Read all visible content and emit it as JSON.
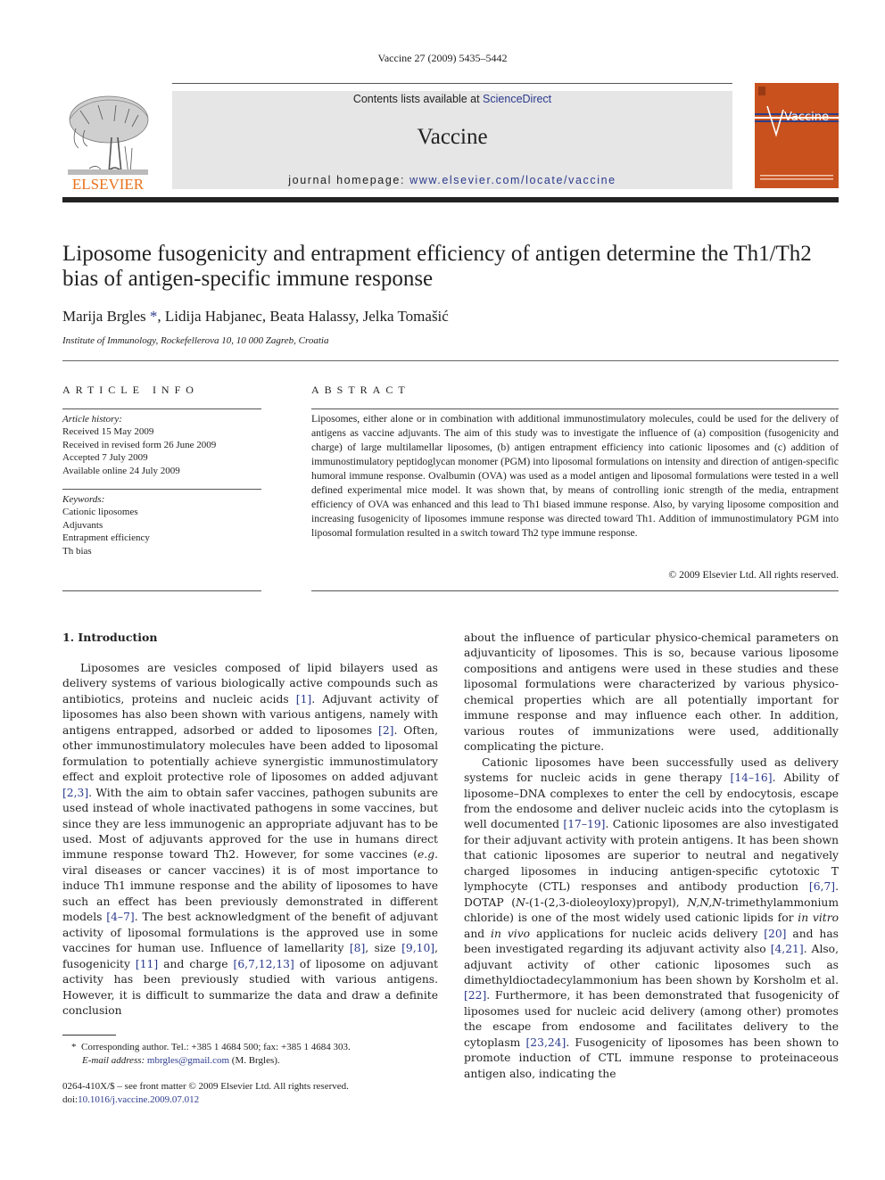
{
  "header": {
    "journal_ref": "Vaccine 27 (2009) 5435–5442",
    "contents_prefix": "Contents lists available at ",
    "contents_link": "ScienceDirect",
    "journal_name": "Vaccine",
    "homepage_prefix": "journal homepage: ",
    "homepage_link": "www.elsevier.com/locate/vaccine",
    "publisher_logo_text": "ELSEVIER",
    "cover_title": "Vaccine",
    "colors": {
      "publisher_orange": "#e9711c",
      "cover_orange": "#c8511e",
      "link_blue": "#2b3a8c",
      "header_gray": "#e6e6e6"
    }
  },
  "article": {
    "title": "Liposome fusogenicity and entrapment efficiency of antigen determine the Th1/Th2 bias of antigen-specific immune response",
    "authors_first": "Marija Brgles",
    "author_mark": "*",
    "authors_rest": ", Lidija Habjanec, Beata Halassy, Jelka Tomašić",
    "affiliation": "Institute of Immunology, Rockefellerova 10, 10 000 Zagreb, Croatia"
  },
  "article_info": {
    "heading": "ARTICLE INFO",
    "history_label": "Article history:",
    "history": [
      "Received 15 May 2009",
      "Received in revised form 26 June 2009",
      "Accepted 7 July 2009",
      "Available online 24 July 2009"
    ],
    "keywords_label": "Keywords:",
    "keywords": [
      "Cationic liposomes",
      "Adjuvants",
      "Entrapment efficiency",
      "Th bias"
    ]
  },
  "abstract": {
    "heading": "ABSTRACT",
    "text": "Liposomes, either alone or in combination with additional immunostimulatory molecules, could be used for the delivery of antigens as vaccine adjuvants. The aim of this study was to investigate the influence of (a) composition (fusogenicity and charge) of large multilamellar liposomes, (b) antigen entrapment efficiency into cationic liposomes and (c) addition of immunostimulatory peptidoglycan monomer (PGM) into liposomal formulations on intensity and direction of antigen-specific humoral immune response. Ovalbumin (OVA) was used as a model antigen and liposomal formulations were tested in a well defined experimental mice model. It was shown that, by means of controlling ionic strength of the media, entrapment efficiency of OVA was enhanced and this lead to Th1 biased immune response. Also, by varying liposome composition and increasing fusogenicity of liposomes immune response was directed toward Th1. Addition of immunostimulatory PGM into liposomal formulation resulted in a switch toward Th2 type immune response.",
    "copyright": "© 2009 Elsevier Ltd. All rights reserved."
  },
  "body": {
    "section_heading": "1.  Introduction",
    "left": {
      "p1": [
        {
          "t": "Liposomes are vesicles composed of lipid bilayers used as delivery systems of various biologically active compounds such as antibiotics, proteins and nucleic acids "
        },
        {
          "c": "[1]"
        },
        {
          "t": ". Adjuvant activity of liposomes has also been shown with various antigens, namely with antigens entrapped, adsorbed or added to liposomes "
        },
        {
          "c": "[2]"
        },
        {
          "t": ". Often, other immunostimulatory molecules have been added to liposomal formulation to potentially achieve synergistic immunostimulatory effect and exploit protective role of liposomes on added adjuvant "
        },
        {
          "c": "[2,3]"
        },
        {
          "t": ". With the aim to obtain safer vaccines, pathogen subunits are used instead of whole inactivated pathogens in some vaccines, but since they are less immunogenic an appropriate adjuvant has to be used. Most of adjuvants approved for the use in humans direct immune response toward Th2. However, for some vaccines ("
        },
        {
          "i": "e.g."
        },
        {
          "t": " viral diseases or cancer vaccines) it is of most importance to induce Th1 immune response and the ability of liposomes to have such an effect has been previously demonstrated in different models "
        },
        {
          "c": "[4–7]"
        },
        {
          "t": ". The best acknowledgment of the benefit of adjuvant activity of liposomal formulations is the approved use in some vaccines for human use. Influence of lamellarity "
        },
        {
          "c": "[8]"
        },
        {
          "t": ", size "
        },
        {
          "c": "[9,10]"
        },
        {
          "t": ", fusogenicity "
        },
        {
          "c": "[11]"
        },
        {
          "t": " and charge "
        },
        {
          "c": "[6,7,12,13]"
        },
        {
          "t": " of liposome on adjuvant activity has been previously studied with various antigens. However, it is difficult to summarize the data and draw a definite conclusion"
        }
      ]
    },
    "right": {
      "p1": [
        {
          "t": "about the influence of particular physico-chemical parameters on adjuvanticity of liposomes. This is so, because various liposome compositions and antigens were used in these studies and these liposomal formulations were characterized by various physico-chemical properties which are all potentially important for immune response and may influence each other. In addition, various routes of immunizations were used, additionally complicating the picture."
        }
      ],
      "p2": [
        {
          "t": "Cationic liposomes have been successfully used as delivery systems for nucleic acids in gene therapy "
        },
        {
          "c": "[14–16]"
        },
        {
          "t": ". Ability of liposome–DNA complexes to enter the cell by endocytosis, escape from the endosome and deliver nucleic acids into the cytoplasm is well documented "
        },
        {
          "c": "[17–19]"
        },
        {
          "t": ". Cationic liposomes are also investigated for their adjuvant activity with protein antigens. It has been shown that cationic liposomes are superior to neutral and negatively charged liposomes in inducing antigen-specific cytotoxic T lymphocyte (CTL) responses and antibody production "
        },
        {
          "c": "[6,7]"
        },
        {
          "t": ". DOTAP ("
        },
        {
          "i": "N"
        },
        {
          "t": "-(1-(2,3-dioleoyloxy)propyl), "
        },
        {
          "i": "N,N,N"
        },
        {
          "t": "-trimethylammonium chloride) is one of the most widely used cationic lipids for "
        },
        {
          "i": "in vitro"
        },
        {
          "t": " and "
        },
        {
          "i": "in vivo"
        },
        {
          "t": " applications for nucleic acids delivery "
        },
        {
          "c": "[20]"
        },
        {
          "t": " and has been investigated regarding its adjuvant activity also "
        },
        {
          "c": "[4,21]"
        },
        {
          "t": ". Also, adjuvant activity of other cationic liposomes such as dimethyldioctadecylammonium has been shown by Korsholm et al. "
        },
        {
          "c": "[22]"
        },
        {
          "t": ". Furthermore, it has been demonstrated that fusogenicity of liposomes used for nucleic acid delivery (among other) promotes the escape from endosome and facilitates delivery to the cytoplasm "
        },
        {
          "c": "[23,24]"
        },
        {
          "t": ". Fusogenicity of liposomes has been shown to promote induction of CTL immune response to proteinaceous antigen also, indicating the"
        }
      ]
    }
  },
  "footnote": {
    "mark": "*",
    "text": "Corresponding author. Tel.: +385 1 4684 500; fax: +385 1 4684 303.",
    "email_label": "E-mail address:",
    "email": "mbrgles@gmail.com",
    "email_suffix": " (M. Brgles)."
  },
  "front_matter": {
    "issn_line": "0264-410X/$ – see front matter © 2009 Elsevier Ltd. All rights reserved.",
    "doi_prefix": "doi:",
    "doi": "10.1016/j.vaccine.2009.07.012"
  }
}
